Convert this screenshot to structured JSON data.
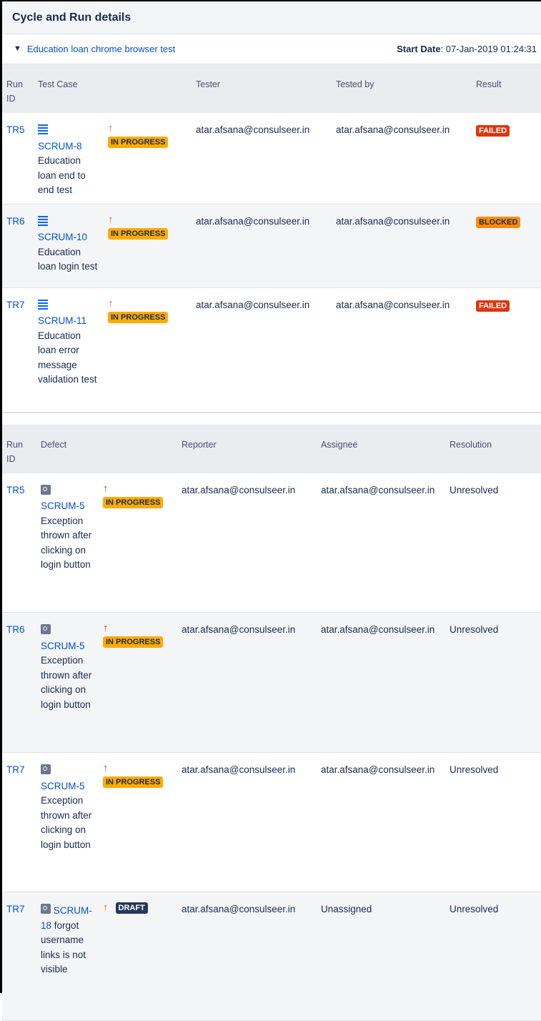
{
  "panel": {
    "title": "Cycle and Run details"
  },
  "cycle": {
    "name": "Education loan chrome browser test",
    "start_label": "Start Date",
    "start_value": ": 07-Jan-2019 01:24:31"
  },
  "runs_table": {
    "headers": [
      "Run ID",
      "Test Case",
      "Tester",
      "Tested by",
      "Result"
    ],
    "rows": [
      {
        "run_id": "TR5",
        "key": "SCRUM-8",
        "summary": "Education loan end to end test",
        "status": "IN PROGRESS",
        "tester": "atar.afsana@consulseer.in",
        "tested_by": "atar.afsana@consulseer.in",
        "result": "FAILED"
      },
      {
        "run_id": "TR6",
        "key": "SCRUM-10",
        "summary": "Education loan login test",
        "status": "IN PROGRESS",
        "tester": "atar.afsana@consulseer.in",
        "tested_by": "atar.afsana@consulseer.in",
        "result": "BLOCKED"
      },
      {
        "run_id": "TR7",
        "key": "SCRUM-11",
        "summary": "Education loan error message validation test",
        "status": "IN PROGRESS",
        "tester": "atar.afsana@consulseer.in",
        "tested_by": "atar.afsana@consulseer.in",
        "result": "FAILED"
      }
    ]
  },
  "defects_table": {
    "headers": [
      "Run ID",
      "Defect",
      "Reporter",
      "Assignee",
      "Resolution"
    ],
    "rows": [
      {
        "run_id": "TR5",
        "key": "SCRUM-5",
        "summary": "Exception thrown after clicking on login button",
        "status": "IN PROGRESS",
        "reporter": "atar.afsana@consulseer.in",
        "assignee": "atar.afsana@consulseer.in",
        "resolution": "Unresolved"
      },
      {
        "run_id": "TR6",
        "key": "SCRUM-5",
        "summary": "Exception thrown after clicking on login button",
        "status": "IN PROGRESS",
        "reporter": "atar.afsana@consulseer.in",
        "assignee": "atar.afsana@consulseer.in",
        "resolution": "Unresolved"
      },
      {
        "run_id": "TR7",
        "key": "SCRUM-5",
        "summary": "Exception thrown after clicking on login button",
        "status": "IN PROGRESS",
        "reporter": "atar.afsana@consulseer.in",
        "assignee": "atar.afsana@consulseer.in",
        "resolution": "Unresolved"
      },
      {
        "run_id": "TR7",
        "key": "SCRUM-18",
        "summary": "forgot username links is not visible",
        "status": "DRAFT",
        "reporter": "atar.afsana@consulseer.in",
        "assignee": "Unassigned",
        "resolution": "Unresolved"
      }
    ]
  },
  "icons": {
    "priority": "arrow-up-icon",
    "story": "story-icon",
    "bug": "bug-icon",
    "collapse": "chevron-down-icon"
  },
  "colors": {
    "link": "#0052cc",
    "failed": "#de350b",
    "blocked": "#ff8b00",
    "in_progress": "#ffab00",
    "draft": "#253858"
  }
}
